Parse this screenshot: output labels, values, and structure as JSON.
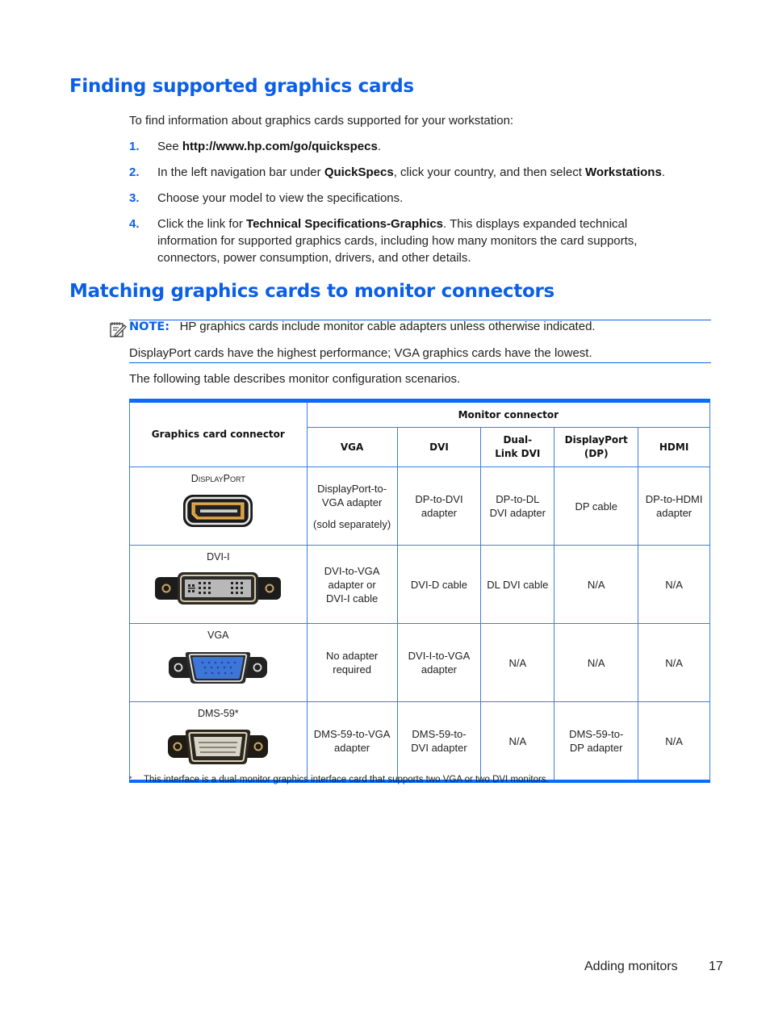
{
  "section1": {
    "title": "Finding supported graphics cards",
    "intro": "To find information about graphics cards supported for your workstation:",
    "steps": [
      {
        "num": "1.",
        "parts": [
          "See ",
          "http://www.hp.com/go/quickspecs",
          "."
        ]
      },
      {
        "num": "2.",
        "parts": [
          "In the left navigation bar under ",
          "QuickSpecs",
          ", click your country, and then select ",
          "Workstations",
          "."
        ]
      },
      {
        "num": "3.",
        "parts": [
          "Choose your model to view the specifications."
        ]
      },
      {
        "num": "4.",
        "parts": [
          "Click the link for ",
          "Technical Specifications-Graphics",
          ". This displays expanded technical information for supported graphics cards, including how many monitors the card supports, connectors, power consumption, drivers, and other details."
        ]
      }
    ]
  },
  "section2": {
    "title": "Matching graphics cards to monitor connectors",
    "note_label": "NOTE:",
    "note_text": "HP graphics cards include monitor cable adapters unless otherwise indicated.",
    "note_text2": "DisplayPort cards have the highest performance; VGA graphics cards have the lowest.",
    "table_intro": "The following table describes monitor configuration scenarios."
  },
  "table": {
    "header_left": "Graphics card connector",
    "header_group": "Monitor connector",
    "columns": [
      "VGA",
      "DVI",
      "Dual-Link DVI",
      "DisplayPort (DP)",
      "HDMI"
    ],
    "rows": [
      {
        "connector": "DisplayPort",
        "icon": "displayport-connector-icon",
        "cells": [
          "DisplayPort-to-VGA adapter",
          "DP-to-DVI adapter",
          "DP-to-DL DVI adapter",
          "DP cable",
          "DP-to-HDMI adapter"
        ],
        "vga_note": "(sold separately)"
      },
      {
        "connector": "DVI-I",
        "icon": "dvi-connector-icon",
        "cells": [
          "DVI-to-VGA adapter or DVI-I cable",
          "DVI-D cable",
          "DL DVI cable",
          "N/A",
          "N/A"
        ]
      },
      {
        "connector": "VGA",
        "icon": "vga-connector-icon",
        "cells": [
          "No adapter required",
          "DVI-I-to-VGA adapter",
          "N/A",
          "N/A",
          "N/A"
        ]
      },
      {
        "connector": "DMS-59*",
        "icon": "dms59-connector-icon",
        "cells": [
          "DMS-59-to-VGA adapter",
          "DMS-59-to-DVI adapter",
          "N/A",
          "DMS-59-to-DP adapter",
          "N/A"
        ]
      }
    ],
    "footnote_marker": "*",
    "footnote": "This interface is a dual-monitor graphics interface card that supports two VGA or two DVI monitors."
  },
  "footer": {
    "section": "Adding monitors",
    "page": "17"
  },
  "colors": {
    "accent": "#0a5fe6",
    "table_rule": "#0a6cff"
  }
}
